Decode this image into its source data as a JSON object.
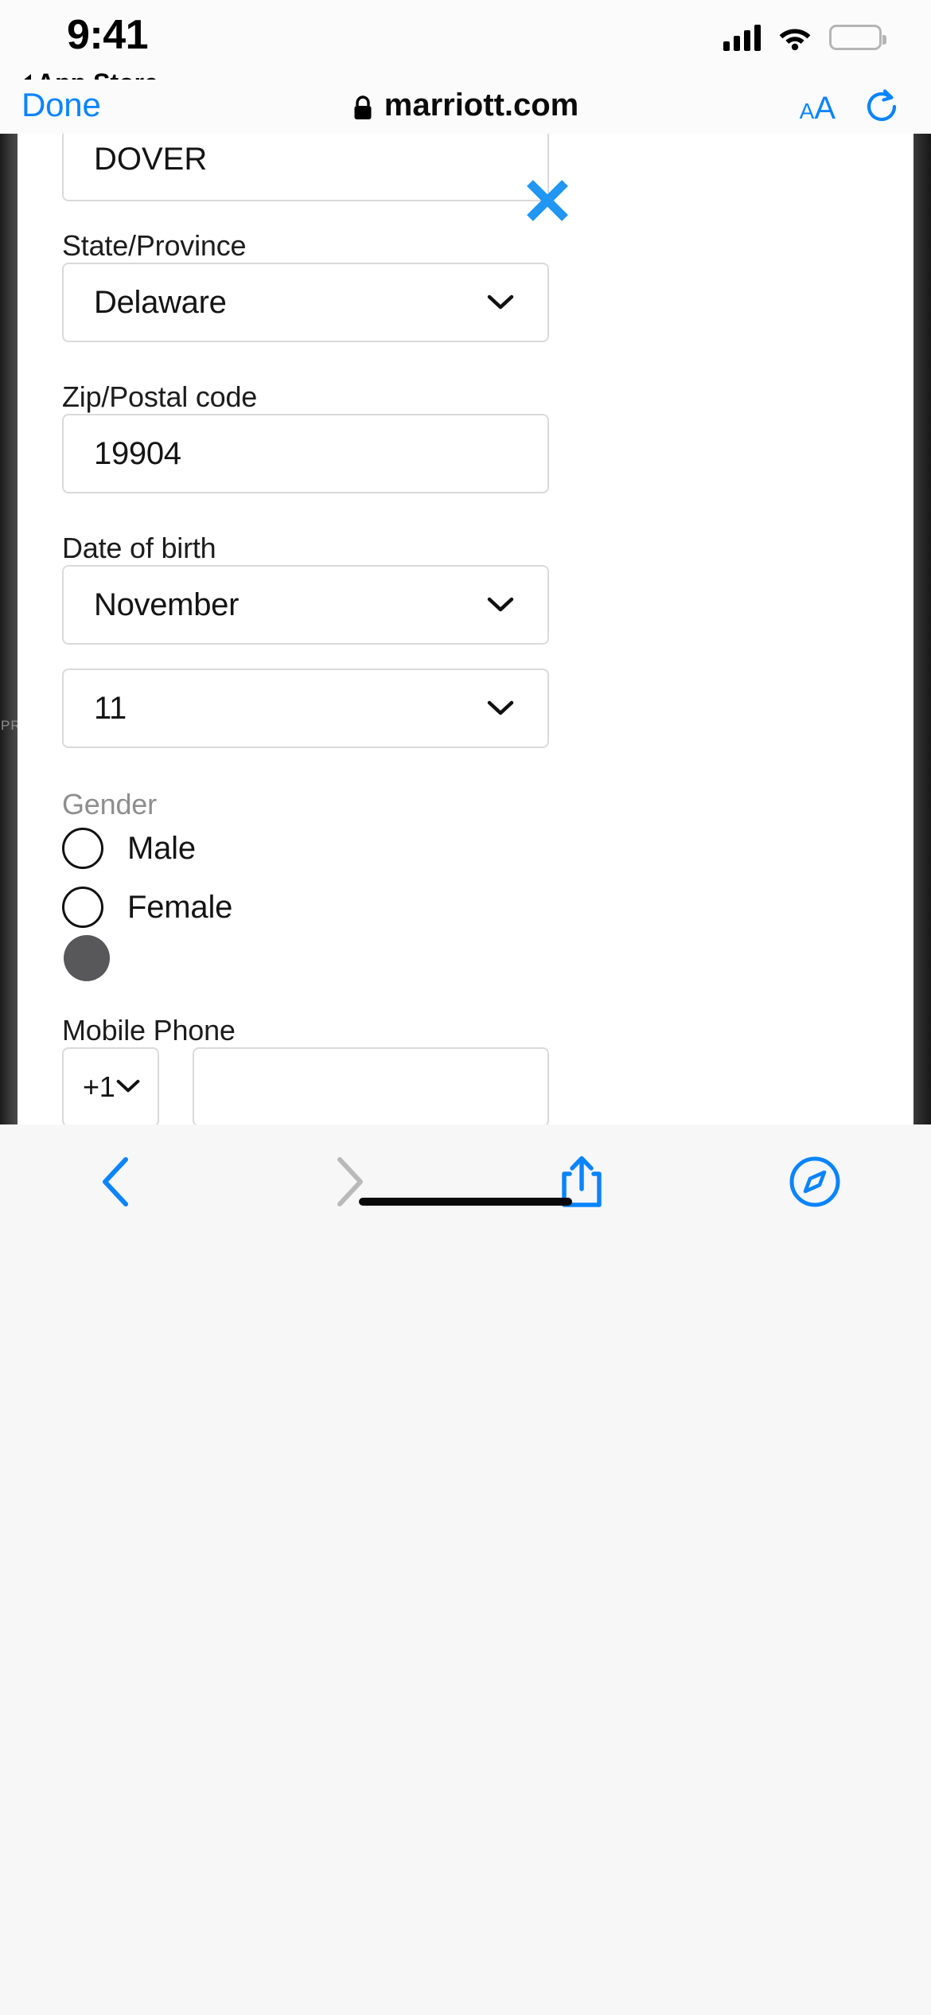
{
  "status_bar": {
    "time": "9:41",
    "back_app_label": "App Store",
    "back_app_icon": "triangle-left-icon",
    "signal_icon": "cellular-signal-icon",
    "wifi_icon": "wifi-icon",
    "battery_icon": "battery-full-icon"
  },
  "browser": {
    "done_label": "Done",
    "lock_icon": "lock-icon",
    "url": "marriott.com",
    "text_size_small": "A",
    "text_size_large": "A",
    "reload_icon": "reload-icon"
  },
  "page": {
    "side_fragment": "PR",
    "city": {
      "value": "DOVER",
      "clear_icon": "close-x-icon"
    },
    "state": {
      "label": "State/Province",
      "value": "Delaware",
      "chevron_icon": "chevron-down-icon"
    },
    "zip": {
      "label": "Zip/Postal code",
      "value": "19904"
    },
    "dob": {
      "label": "Date of birth",
      "month_value": "November",
      "day_value": "11",
      "month_chevron_icon": "chevron-down-icon",
      "day_chevron_icon": "chevron-down-icon"
    },
    "gender": {
      "label": "Gender",
      "options": [
        {
          "label": "Male",
          "selected": false
        },
        {
          "label": "Female",
          "selected": true
        }
      ]
    },
    "mobile_phone": {
      "label": "Mobile Phone",
      "country_code": "+1",
      "country_chevron_icon": "chevron-down-icon",
      "number_value": "",
      "number_placeholder": ""
    }
  },
  "toolbar": {
    "back_icon": "chevron-left-icon",
    "forward_icon": "chevron-right-icon",
    "share_icon": "share-up-icon",
    "tabs_icon": "compass-icon"
  },
  "colors": {
    "accent_blue": "#0a84ff",
    "disabled_gray": "#b9b9b9",
    "field_border": "#dadada",
    "muted_text": "#8e8e8e"
  }
}
